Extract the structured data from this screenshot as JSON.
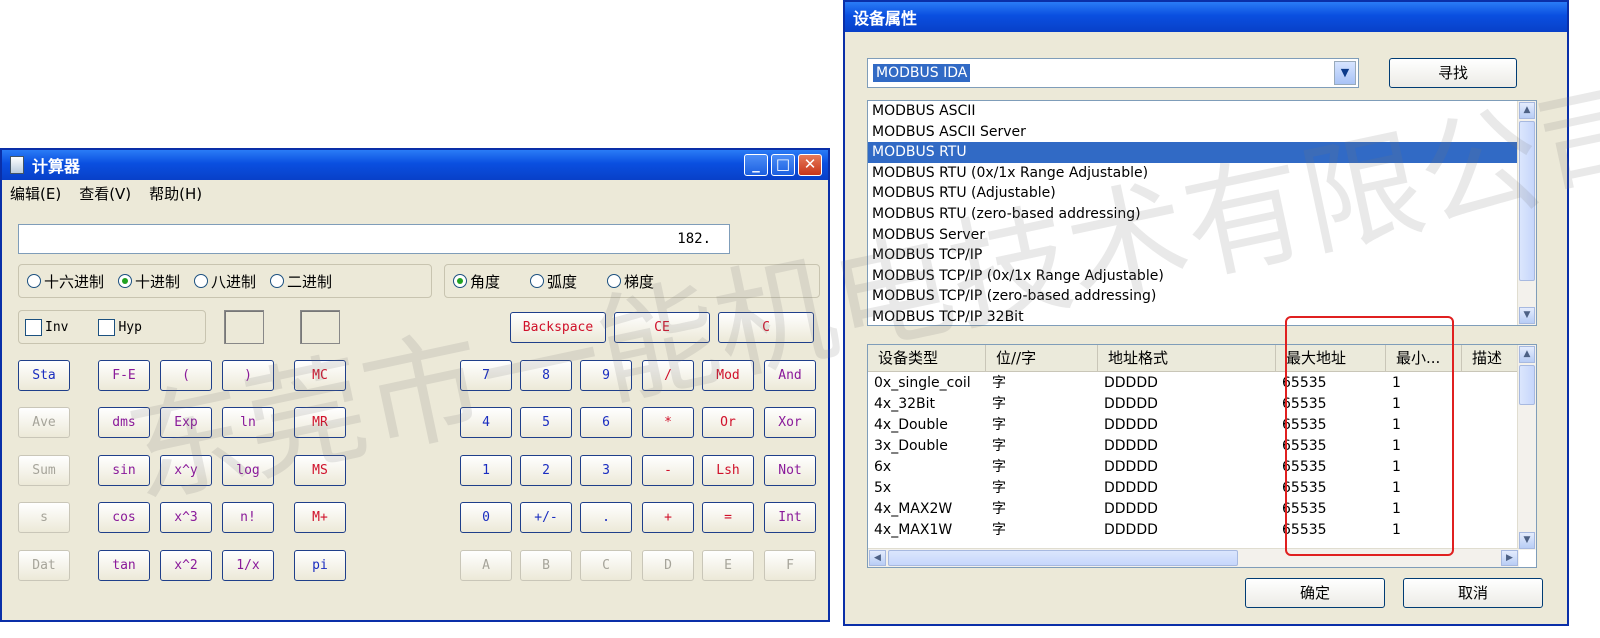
{
  "calculator": {
    "title": "计算器",
    "menu": [
      "编辑(E)",
      "查看(V)",
      "帮助(H)"
    ],
    "display_value": "182.",
    "number_systems": [
      {
        "label": "十六进制",
        "checked": false
      },
      {
        "label": "十进制",
        "checked": true
      },
      {
        "label": "八进制",
        "checked": false
      },
      {
        "label": "二进制",
        "checked": false
      }
    ],
    "angle_units": [
      {
        "label": "角度",
        "checked": true
      },
      {
        "label": "弧度",
        "checked": false
      },
      {
        "label": "梯度",
        "checked": false
      }
    ],
    "checkboxes": [
      {
        "label": "Inv",
        "checked": false
      },
      {
        "label": "Hyp",
        "checked": false
      }
    ],
    "edit_keys": [
      "Backspace",
      "CE",
      "C"
    ],
    "stat_keys": [
      "Sta",
      "Ave",
      "Sum",
      "s",
      "Dat"
    ],
    "func_keys": [
      [
        "F-E",
        "(",
        ")"
      ],
      [
        "dms",
        "Exp",
        "ln"
      ],
      [
        "sin",
        "x^y",
        "log"
      ],
      [
        "cos",
        "x^3",
        "n!"
      ],
      [
        "tan",
        "x^2",
        "1/x"
      ]
    ],
    "mem_keys": [
      "MC",
      "MR",
      "MS",
      "M+",
      "pi"
    ],
    "num_keys": [
      [
        "7",
        "8",
        "9",
        "/",
        "Mod",
        "And"
      ],
      [
        "4",
        "5",
        "6",
        "*",
        "Or",
        "Xor"
      ],
      [
        "1",
        "2",
        "3",
        "-",
        "Lsh",
        "Not"
      ],
      [
        "0",
        "+/-",
        ".",
        "+",
        "=",
        "Int"
      ],
      [
        "A",
        "B",
        "C",
        "D",
        "E",
        "F"
      ]
    ]
  },
  "device_dialog": {
    "title": "设备属性",
    "combo_value": "MODBUS IDA",
    "find_button": "寻找",
    "protocol_list": [
      "MODBUS ASCII",
      "MODBUS ASCII Server",
      "MODBUS RTU",
      "MODBUS RTU (0x/1x Range Adjustable)",
      "MODBUS RTU (Adjustable)",
      "MODBUS RTU (zero-based addressing)",
      "MODBUS Server",
      "MODBUS TCP/IP",
      "MODBUS TCP/IP (0x/1x Range Adjustable)",
      "MODBUS TCP/IP (zero-based addressing)",
      "MODBUS TCP/IP 32Bit"
    ],
    "selected_protocol": "MODBUS RTU",
    "table_headers": [
      "设备类型",
      "位//字",
      "地址格式",
      "最大地址",
      "最小...",
      "描述"
    ],
    "table_rows": [
      [
        "0x_single_coil",
        "字",
        "DDDDD",
        "65535",
        "1",
        ""
      ],
      [
        "4x_32Bit",
        "字",
        "DDDDD",
        "65535",
        "1",
        ""
      ],
      [
        "4x_Double",
        "字",
        "DDDDD",
        "65535",
        "1",
        ""
      ],
      [
        "3x_Double",
        "字",
        "DDDDD",
        "65535",
        "1",
        ""
      ],
      [
        "6x",
        "字",
        "DDDDD",
        "65535",
        "1",
        ""
      ],
      [
        "5x",
        "字",
        "DDDDD",
        "65535",
        "1",
        ""
      ],
      [
        "4x_MAX2W",
        "字",
        "DDDDD",
        "65535",
        "1",
        ""
      ],
      [
        "4x_MAX1W",
        "字",
        "DDDDD",
        "65535",
        "1",
        ""
      ]
    ],
    "ok_button": "确定",
    "cancel_button": "取消"
  },
  "watermark": "东莞市一能机电技术有限公司",
  "colors": {
    "titlebar": "#0a4fe0",
    "selection": "#316ac5",
    "highlight_box": "#e02020",
    "window_bg": "#ece9d8"
  }
}
